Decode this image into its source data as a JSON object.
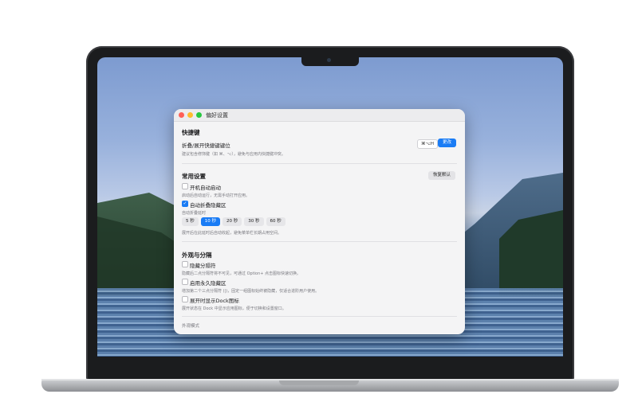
{
  "window": {
    "title": "偏好设置"
  },
  "shortcut": {
    "section_title": "快捷键",
    "label": "折叠/展开快捷键键位",
    "key": "⌘⌥H",
    "change_button": "更改",
    "hint": "建议包含修饰键（如 ⌘、⌥），避免与应用内快捷键冲突。"
  },
  "general": {
    "section_title": "常用设置",
    "reset_button": "恢复默认",
    "launch_at_login": {
      "label": "开机自动启动",
      "checked": false,
      "hint": "启动后自动运行，无需手动打开应用。"
    },
    "auto_collapse": {
      "label": "自动折叠隐藏区",
      "checked": true
    },
    "delay_label": "自动折叠延时",
    "delay_options": [
      "5 秒",
      "10 秒",
      "20 秒",
      "30 秒",
      "60 秒"
    ],
    "delay_selected": "10 秒",
    "delay_hint": "展开后在此延时后自动收起，避免菜单栏长期占用空间。"
  },
  "appearance": {
    "section_title": "外观与分隔",
    "hide_separator": {
      "label": "隐藏分隔符",
      "checked": false,
      "hint": "隐藏后二点分隔符将不可见，可通过 Option+ 点击图标快速切换。"
    },
    "permanent_hide": {
      "label": "启用永久隐藏区",
      "checked": false,
      "hint": "增加第二个三点分隔符 (|)，固定一组图标始终被隐藏，仅适合进阶用户使用。"
    },
    "show_dock_icon": {
      "label": "展开时显示Dock图标",
      "checked": false,
      "hint": "展开状态在 Dock 中显示应用图标，便于切换和设置窗口。"
    }
  },
  "footer": {
    "label": "外观模式"
  },
  "colors": {
    "accent": "#1a7cf5",
    "window_bg": "#f4f4f5",
    "bezel": "#1b1c1e"
  }
}
